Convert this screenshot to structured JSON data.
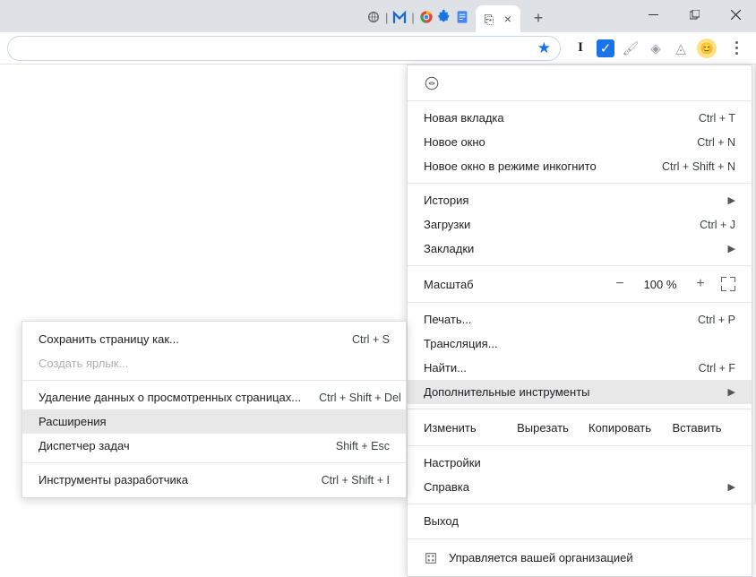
{
  "window_controls": {
    "minimize": "minimize",
    "maximize": "maximize",
    "close": "close"
  },
  "toolbar": {
    "bookmark_icon": "star",
    "ext_i_label": "I",
    "profile_face": "😊"
  },
  "main_menu": {
    "new_tab": {
      "label": "Новая вкладка",
      "shortcut": "Ctrl + T"
    },
    "new_window": {
      "label": "Новое окно",
      "shortcut": "Ctrl + N"
    },
    "new_incognito": {
      "label": "Новое окно в режиме инкогнито",
      "shortcut": "Ctrl + Shift + N"
    },
    "history": {
      "label": "История"
    },
    "downloads": {
      "label": "Загрузки",
      "shortcut": "Ctrl + J"
    },
    "bookmarks": {
      "label": "Закладки"
    },
    "zoom": {
      "label": "Масштаб",
      "minus": "−",
      "value": "100 %",
      "plus": "+"
    },
    "print": {
      "label": "Печать...",
      "shortcut": "Ctrl + P"
    },
    "cast": {
      "label": "Трансляция..."
    },
    "find": {
      "label": "Найти...",
      "shortcut": "Ctrl + F"
    },
    "more_tools": {
      "label": "Дополнительные инструменты"
    },
    "edit": {
      "label": "Изменить",
      "cut": "Вырезать",
      "copy": "Копировать",
      "paste": "Вставить"
    },
    "settings": {
      "label": "Настройки"
    },
    "help": {
      "label": "Справка"
    },
    "exit": {
      "label": "Выход"
    },
    "managed": {
      "label": "Управляется вашей организацией"
    }
  },
  "submenu": {
    "save_page": {
      "label": "Сохранить страницу как...",
      "shortcut": "Ctrl + S"
    },
    "create_shortcut": {
      "label": "Создать ярлык..."
    },
    "clear_browsing": {
      "label": "Удаление данных о просмотренных страницах...",
      "shortcut": "Ctrl + Shift + Del"
    },
    "extensions": {
      "label": "Расширения"
    },
    "task_manager": {
      "label": "Диспетчер задач",
      "shortcut": "Shift + Esc"
    },
    "dev_tools": {
      "label": "Инструменты разработчика",
      "shortcut": "Ctrl + Shift + I"
    }
  }
}
